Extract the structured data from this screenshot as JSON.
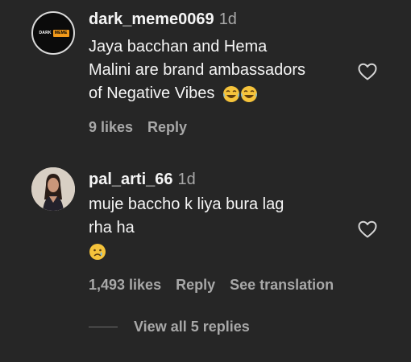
{
  "comments": [
    {
      "username": "dark_meme0069",
      "time": "1d",
      "text_lines": [
        "Jaya bacchan and Hema",
        "Malini are brand ambassadors",
        "of Negative Vibes"
      ],
      "emoji_icons": [
        "face-with-tears-of-joy-icon",
        "face-with-tears-of-joy-icon"
      ],
      "likes": "9 likes",
      "reply": "Reply",
      "avatar_logo": [
        "DARK",
        "MEME"
      ]
    },
    {
      "username": "pal_arti_66",
      "time": "1d",
      "text_lines": [
        "muje baccho k liya bura lag",
        "rha ha"
      ],
      "emoji_icons": [
        "crying-face-icon"
      ],
      "likes": "1,493 likes",
      "reply": "Reply",
      "see_translation": "See translation"
    }
  ],
  "view_replies": "View all 5 replies",
  "colors": {
    "background": "#262626",
    "primary_text": "#f5f5f5",
    "secondary_text": "#a8a8a8",
    "emoji_yellow": "#f5c33b"
  }
}
